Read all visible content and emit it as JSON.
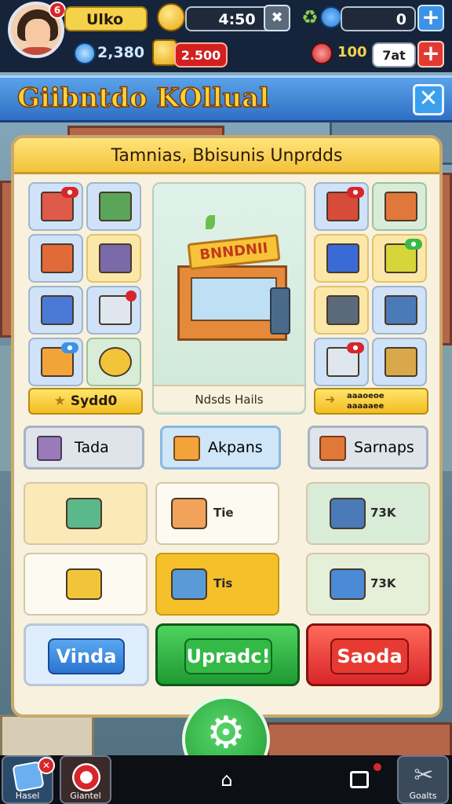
{
  "hud": {
    "player_name": "Ulko",
    "timer": "4:50",
    "counter": "0",
    "gems": "2,380",
    "gold": "2.500",
    "level": "100",
    "energy": "7at",
    "avatar_badge": "6"
  },
  "header": {
    "title": "Giibntdo KOllual"
  },
  "panel": {
    "heading": "Tamnias, Bbisunis Unprdds",
    "left_button": "Sydd0",
    "center_label": "Ndsds Hails",
    "right_button_line1": "aaaoeoe",
    "right_button_line2": "aaaaaee",
    "shop_sign": "BNNDNII"
  },
  "tabs": [
    {
      "label": "Tada"
    },
    {
      "label": "Akpans"
    },
    {
      "label": "Sarnaps"
    }
  ],
  "cards": [
    {
      "label": ""
    },
    {
      "label": "Tie"
    },
    {
      "label": "73K"
    },
    {
      "label": ""
    },
    {
      "label": "Tis"
    },
    {
      "label": "73K"
    }
  ],
  "actions": {
    "left": "Vinda",
    "center": "Upradc!",
    "right": "Saoda"
  },
  "bottom_nav": {
    "left": "Hasel",
    "second": "Giantel",
    "right": "Goalts"
  },
  "colors": {
    "accent_blue": "#3c93e6",
    "accent_green": "#2fb844",
    "accent_red": "#e23a32",
    "gold": "#f2bd22"
  }
}
